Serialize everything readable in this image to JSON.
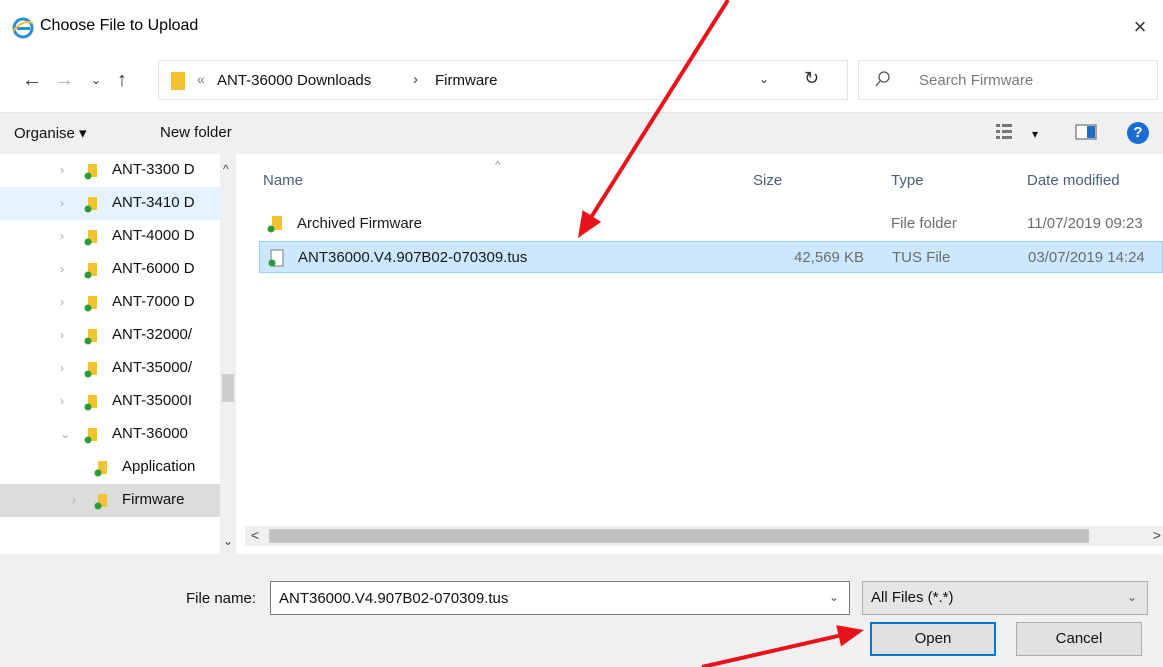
{
  "window": {
    "title": "Choose File to Upload",
    "close_glyph": "×"
  },
  "nav": {
    "back_glyph": "←",
    "forward_glyph": "→",
    "recent_glyph": "⌄",
    "up_glyph": "↑",
    "overflow_glyph": "«",
    "breadcrumb": [
      "ANT-36000 Downloads",
      "Firmware"
    ],
    "separator_glyph": "›",
    "dropdown_glyph": "⌄",
    "refresh_glyph": "↻"
  },
  "search": {
    "placeholder": "Search Firmware"
  },
  "commands": {
    "organise": "Organise ▾",
    "new_folder": "New folder",
    "view_dropdown": "▾",
    "help": "?"
  },
  "tree": [
    {
      "label": "ANT-3300 D",
      "indent": 1,
      "expander": "›"
    },
    {
      "label": "ANT-3410 D",
      "indent": 1,
      "expander": "›",
      "hover": true
    },
    {
      "label": "ANT-4000 D",
      "indent": 1,
      "expander": "›"
    },
    {
      "label": "ANT-6000 D",
      "indent": 1,
      "expander": "›"
    },
    {
      "label": "ANT-7000 D",
      "indent": 1,
      "expander": "›"
    },
    {
      "label": "ANT-32000/",
      "indent": 1,
      "expander": "›"
    },
    {
      "label": "ANT-35000/",
      "indent": 1,
      "expander": "›"
    },
    {
      "label": "ANT-35000I",
      "indent": 1,
      "expander": "›"
    },
    {
      "label": "ANT-36000",
      "indent": 1,
      "expander": "⌄"
    },
    {
      "label": "Application",
      "indent": 2,
      "expander": ""
    },
    {
      "label": "Firmware",
      "indent": 2,
      "expander": "›",
      "selected": true
    }
  ],
  "tree_scroll": {
    "up": "^",
    "down": "⌄"
  },
  "columns": {
    "name": "Name",
    "size": "Size",
    "type": "Type",
    "date": "Date modified",
    "sort_caret": "^"
  },
  "files": [
    {
      "name": "Archived Firmware",
      "size": "",
      "type": "File folder",
      "date": "11/07/2019 09:23",
      "kind": "folder"
    },
    {
      "name": "ANT36000.V4.907B02-070309.tus",
      "size": "42,569 KB",
      "type": "TUS File",
      "date": "03/07/2019 14:24",
      "kind": "file",
      "selected": true
    }
  ],
  "hscroll": {
    "left": "<",
    "right": ">"
  },
  "bottom": {
    "file_name_label": "File name:",
    "file_name_value": "ANT36000.V4.907B02-070309.tus",
    "file_type_value": "All Files (*.*)",
    "dropdown_glyph": "⌄",
    "open_label": "Open",
    "cancel_label": "Cancel"
  },
  "colors": {
    "annotation_arrow": "#e8141c",
    "selection": "#cce8ff",
    "primary_border": "#0078d7",
    "folder": "#f1c233"
  }
}
